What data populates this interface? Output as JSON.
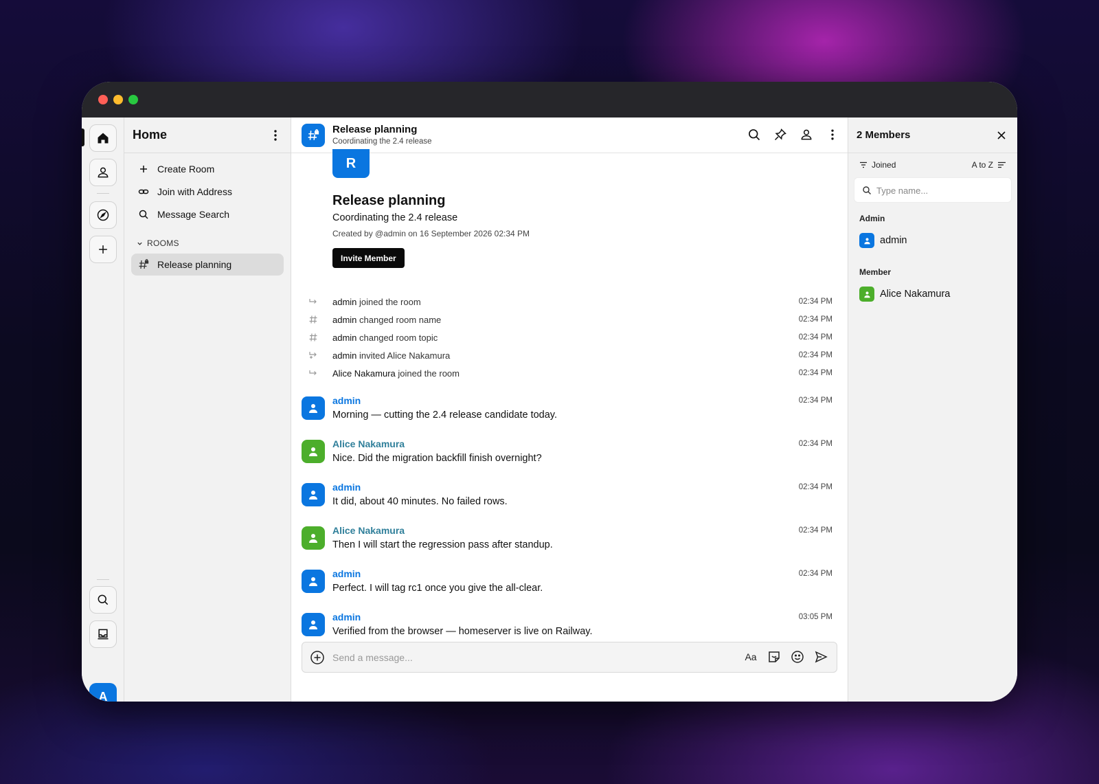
{
  "colors": {
    "accent": "#0a76e0",
    "admin_avatar": "#0a76e0",
    "alice_avatar": "#4cae2b",
    "admin_name": "#0a76e0",
    "alice_name": "#2f7f9a"
  },
  "rail": {
    "items": [
      "home-icon",
      "user-icon",
      "compass-icon",
      "plus-icon",
      "search-icon",
      "inbox-icon"
    ],
    "avatar_letter": "A"
  },
  "sidebar": {
    "title": "Home",
    "actions": [
      {
        "label": "Create Room",
        "icon": "plus-icon"
      },
      {
        "label": "Join with Address",
        "icon": "link-icon"
      },
      {
        "label": "Message Search",
        "icon": "search-icon"
      }
    ],
    "section_label": "ROOMS",
    "rooms": [
      {
        "label": "Release planning",
        "icon": "hash-lock-icon"
      }
    ]
  },
  "room": {
    "name": "Release planning",
    "topic": "Coordinating the 2.4 release",
    "avatar_letter": "R",
    "created_text": "Created by @admin on 16 September 2026 02:34 PM",
    "invite_label": "Invite Member"
  },
  "events": [
    {
      "icon": "arrow-join-icon",
      "actor": "admin",
      "text": " joined the room",
      "time": "02:34 PM"
    },
    {
      "icon": "hash-icon",
      "actor": "admin",
      "text": " changed room name",
      "time": "02:34 PM"
    },
    {
      "icon": "hash-icon",
      "actor": "admin",
      "text": " changed room topic",
      "time": "02:34 PM"
    },
    {
      "icon": "invite-icon",
      "actor": "admin",
      "text": " invited Alice Nakamura",
      "time": "02:34 PM"
    },
    {
      "icon": "arrow-join-icon",
      "actor": "Alice Nakamura",
      "text": " joined the room",
      "time": "02:34 PM"
    }
  ],
  "messages": [
    {
      "author": "admin",
      "text": "Morning — cutting the 2.4 release candidate today.",
      "time": "02:34 PM"
    },
    {
      "author": "Alice Nakamura",
      "text": "Nice. Did the migration backfill finish overnight?",
      "time": "02:34 PM"
    },
    {
      "author": "admin",
      "text": "It did, about 40 minutes. No failed rows.",
      "time": "02:34 PM"
    },
    {
      "author": "Alice Nakamura",
      "text": "Then I will start the regression pass after standup.",
      "time": "02:34 PM"
    },
    {
      "author": "admin",
      "text": "Perfect. I will tag rc1 once you give the all-clear.",
      "time": "02:34 PM"
    },
    {
      "author": "admin",
      "text": "Verified from the browser — homeserver is live on Railway.",
      "time": "03:05 PM"
    }
  ],
  "composer": {
    "placeholder": "Send a message...",
    "format_label": "Aa"
  },
  "members_panel": {
    "title": "2 Members",
    "filter_label": "Joined",
    "sort_label": "A to Z",
    "search_placeholder": "Type name...",
    "groups": [
      {
        "label": "Admin",
        "members": [
          "admin"
        ]
      },
      {
        "label": "Member",
        "members": [
          "Alice Nakamura"
        ]
      }
    ]
  }
}
